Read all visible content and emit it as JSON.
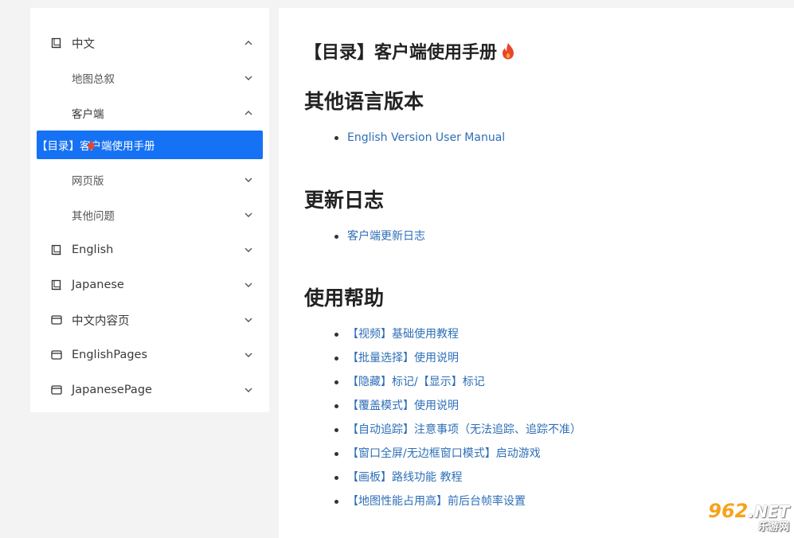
{
  "sidebar": {
    "items": [
      {
        "label": "中文",
        "icon": "book-icon",
        "expanded": true
      },
      {
        "label": "地图总叙",
        "expanded": false
      },
      {
        "label": "客户端",
        "expanded": true
      },
      {
        "label": "【目录】客户端使用手册",
        "icon": "flame-icon",
        "active": true
      },
      {
        "label": "网页版",
        "expanded": false
      },
      {
        "label": "其他问题",
        "expanded": false
      },
      {
        "label": "English",
        "icon": "book-icon",
        "expanded": false
      },
      {
        "label": "Japanese",
        "icon": "book-icon",
        "expanded": false
      },
      {
        "label": "中文内容页",
        "icon": "window-icon",
        "expanded": false
      },
      {
        "label": "EnglishPages",
        "icon": "window-icon",
        "expanded": false
      },
      {
        "label": "JapanesePage",
        "icon": "window-icon",
        "expanded": false
      }
    ]
  },
  "main": {
    "title": "【目录】客户端使用手册",
    "sections": [
      {
        "heading": "其他语言版本",
        "links": [
          "English Version User Manual"
        ]
      },
      {
        "heading": "更新日志",
        "links": [
          "客户端更新日志"
        ]
      },
      {
        "heading": "使用帮助",
        "links": [
          "【视频】基础使用教程",
          "【批量选择】使用说明",
          "【隐藏】标记/【显示】标记",
          "【覆盖模式】使用说明",
          "【自动追踪】注意事项（无法追踪、追踪不准）",
          "【窗口全屏/无边框窗口模式】启动游戏",
          "【画板】路线功能 教程",
          "【地图性能占用高】前后台帧率设置"
        ]
      }
    ]
  },
  "watermark": {
    "brand": "962",
    "suffix": ".NET",
    "subtitle": "乐游网"
  },
  "colors": {
    "accent": "#1672f4",
    "link": "#2e6fb7",
    "flame": "#e8452c"
  }
}
